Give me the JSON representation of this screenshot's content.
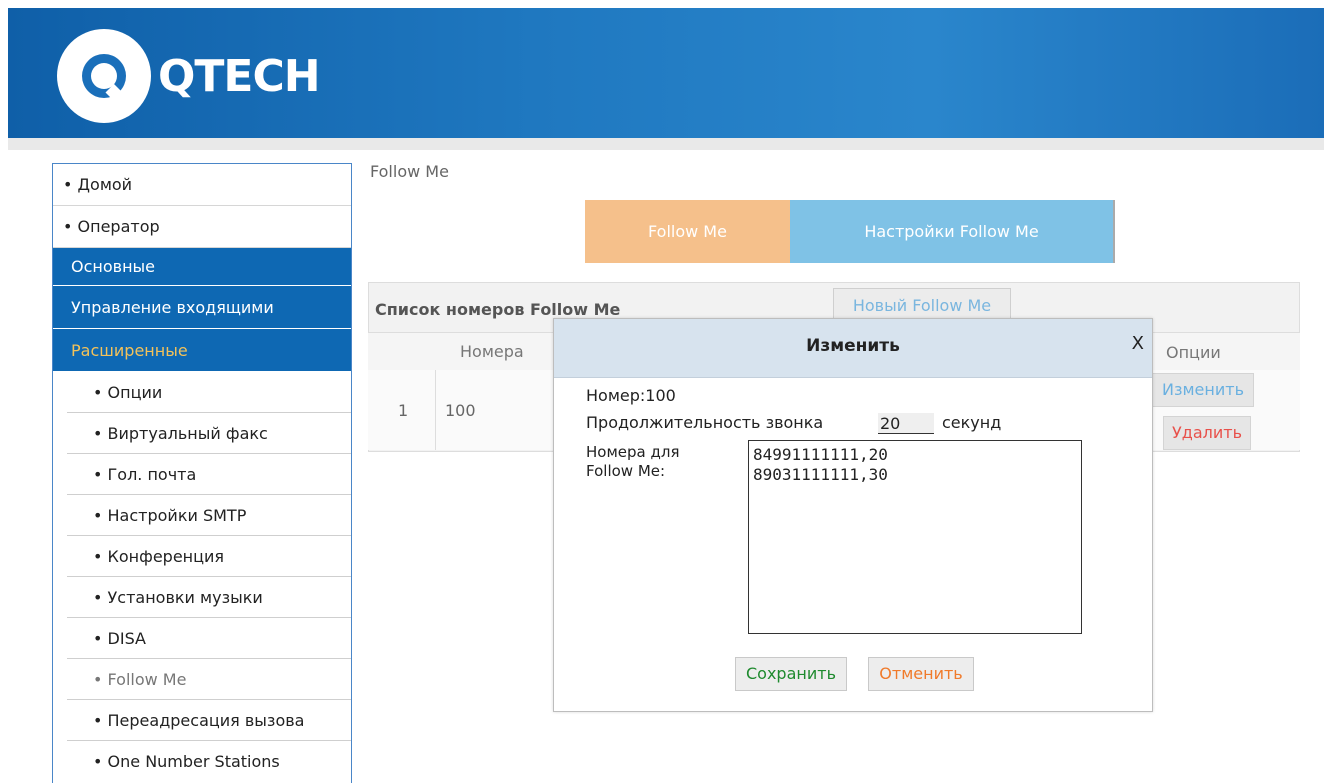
{
  "header": {
    "logo_text": "QTECH"
  },
  "sidebar": {
    "top_items": [
      "• Домой",
      "• Оператор"
    ],
    "sections": [
      "Основные",
      "Управление входящими",
      "Расширенные"
    ],
    "sub_items": [
      "• Опции",
      "• Виртуальный факс",
      "• Гол. почта",
      "• Настройки SMTP",
      "• Конференция",
      "• Установки музыки",
      "• DISA",
      "• Follow Me",
      "• Переадресация вызова",
      "• One Number Stations"
    ]
  },
  "main": {
    "breadcrumb": "Follow Me",
    "tabs": [
      "Follow Me",
      "Настройки Follow Me"
    ],
    "list_title": "Список номеров Follow Me",
    "new_button": "Новый Follow Me",
    "columns": [
      "Номера",
      "Опции"
    ],
    "rows": [
      {
        "index": "1",
        "number": "100"
      }
    ],
    "edit_label": "Изменить",
    "delete_label": "Удалить"
  },
  "modal": {
    "title": "Изменить",
    "close": "X",
    "number_line": "Номер:100",
    "duration_label": "Продолжительность звонка",
    "duration_value": "20",
    "duration_unit": "секунд",
    "numbers_label_1": "Номера для",
    "numbers_label_2": "Follow Me:",
    "numbers_text": "84991111111,20\n89031111111,30",
    "save_label": "Сохранить",
    "cancel_label": "Отменить"
  },
  "colors": {
    "header_blue": "#1f78c0",
    "nav_blue": "#0e68b3",
    "active_section": "#f3c25a",
    "tab_orange": "#f5c08b",
    "tab_blue": "#7fc2e6"
  }
}
